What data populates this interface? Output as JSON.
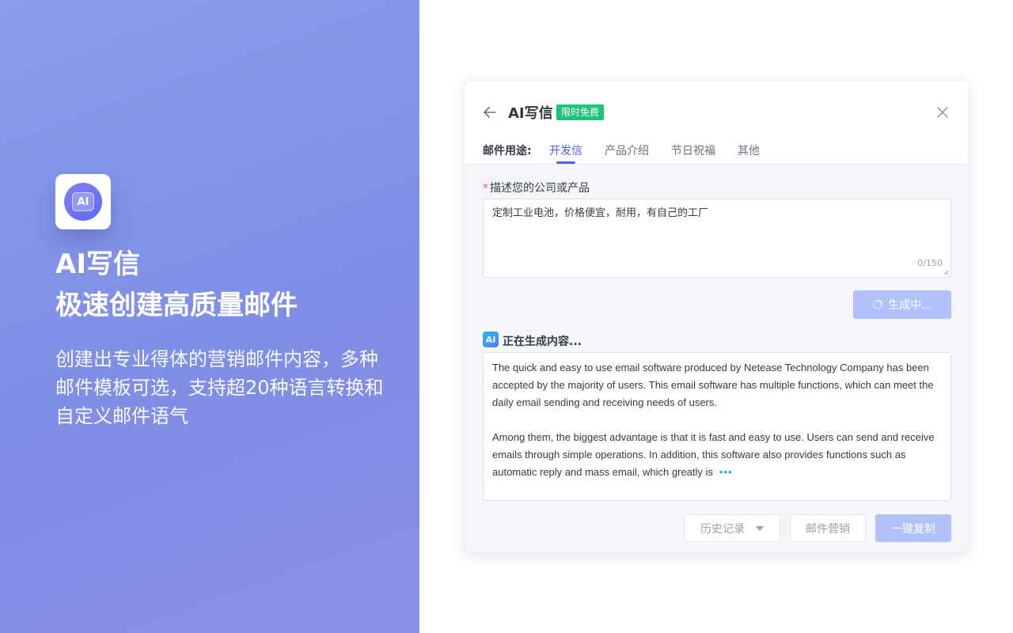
{
  "promo": {
    "icon_text": "AI",
    "title": "AI写信",
    "subtitle": "极速创建高质量邮件",
    "description": "创建出专业得体的营销邮件内容，多种邮件模板可选，支持超20种语言转换和自定义邮件语气"
  },
  "dialog": {
    "title": "AI写信",
    "badge": "限时免费",
    "usage_label": "邮件用途:",
    "tabs": [
      {
        "label": "开发信",
        "active": true
      },
      {
        "label": "产品介绍",
        "active": false
      },
      {
        "label": "节日祝福",
        "active": false
      },
      {
        "label": "其他",
        "active": false
      }
    ],
    "field_required_mark": "*",
    "field_label": "描述您的公司或产品",
    "description_value": "定制工业电池，价格便宜，耐用，有自己的工厂",
    "char_count": "0/150",
    "generate_button": "生成中...",
    "status_icon_text": "AI",
    "status_text": "正在生成内容...",
    "output_paragraphs": [
      "The quick and easy to use email software produced by Netease Technology Company has been accepted by the majority of users. This email software has multiple functions, which can meet the daily email sending and receiving needs of users.",
      "Among them, the biggest advantage is that it is fast and easy to use. Users can send and receive emails through simple operations. In addition, this software also provides functions such as automatic reply and mass email, which greatly is"
    ],
    "typing_indicator": "•••",
    "buttons": {
      "history": "历史记录",
      "marketing": "邮件营销",
      "copy": "一键复制"
    }
  },
  "colors": {
    "primary": "#4a5ff0",
    "primary_disabled": "#b2c0fb",
    "badge_green": "#1fc37a",
    "required_red": "#f05a4a",
    "promo_bg": "#8291e7"
  },
  "icons": [
    "ai-app-icon",
    "back-arrow-icon",
    "close-icon",
    "spinner-icon",
    "ai-badge-icon",
    "caret-down-icon"
  ]
}
